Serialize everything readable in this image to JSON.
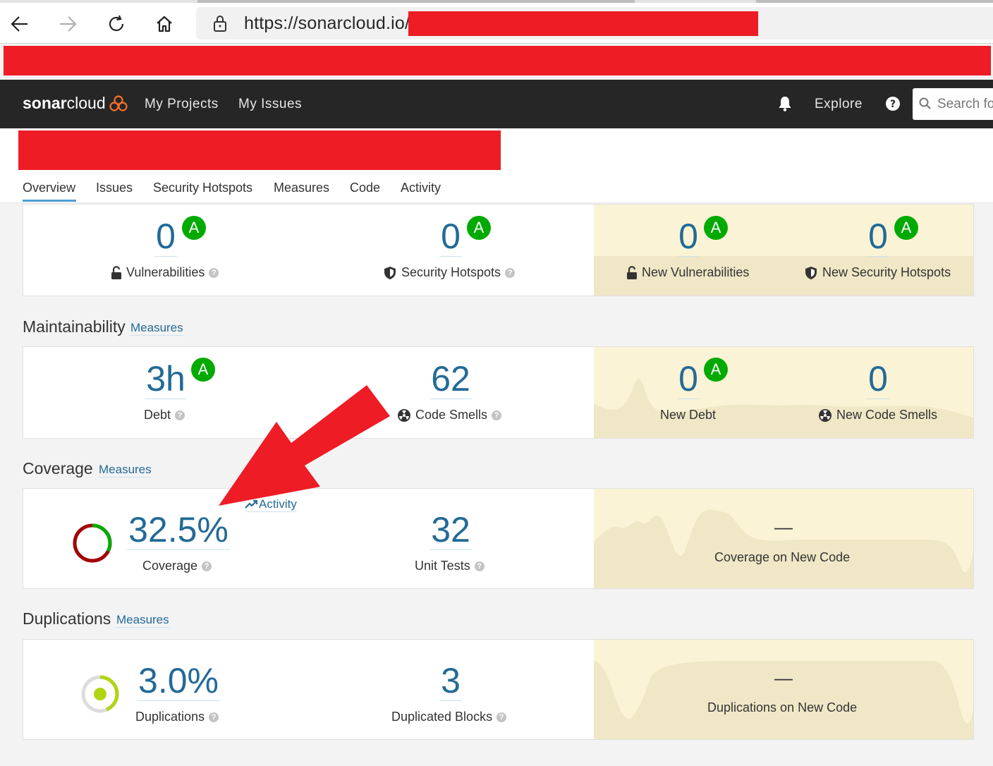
{
  "browser": {
    "url": "https://sonarcloud.io/"
  },
  "header": {
    "logo_bold": "sonar",
    "logo_thin": "cloud",
    "my_projects": "My Projects",
    "my_issues": "My Issues",
    "explore": "Explore",
    "search_placeholder": "Search fo"
  },
  "tabs": [
    "Overview",
    "Issues",
    "Security Hotspots",
    "Measures",
    "Code",
    "Activity"
  ],
  "security": {
    "vulnerabilities": {
      "value": "0",
      "grade": "A",
      "label": "Vulnerabilities"
    },
    "hotspots": {
      "value": "0",
      "grade": "A",
      "label": "Security Hotspots"
    },
    "new_vulnerabilities": {
      "value": "0",
      "grade": "A",
      "label": "New Vulnerabilities"
    },
    "new_hotspots": {
      "value": "0",
      "grade": "A",
      "label": "New Security Hotspots"
    }
  },
  "maintainability": {
    "title": "Maintainability",
    "link": "Measures",
    "debt": {
      "value": "3h",
      "grade": "A",
      "label": "Debt"
    },
    "code_smells": {
      "value": "62",
      "label": "Code Smells"
    },
    "new_debt": {
      "value": "0",
      "grade": "A",
      "label": "New Debt"
    },
    "new_code_smells": {
      "value": "0",
      "label": "New Code Smells"
    }
  },
  "coverage": {
    "title": "Coverage",
    "link": "Measures",
    "activity_link": "Activity",
    "coverage": {
      "value": "32.5%",
      "label": "Coverage",
      "percent": 32.5
    },
    "unit_tests": {
      "value": "32",
      "label": "Unit Tests"
    },
    "new_code": {
      "value": "—",
      "label": "Coverage on New Code"
    }
  },
  "duplications": {
    "title": "Duplications",
    "link": "Measures",
    "duplications": {
      "value": "3.0%",
      "label": "Duplications"
    },
    "blocks": {
      "value": "3",
      "label": "Duplicated Blocks"
    },
    "new_code": {
      "value": "—",
      "label": "Duplications on New Code"
    }
  },
  "colors": {
    "link": "#236a97",
    "grade_a": "#00aa00",
    "new_code_bg": "#fbf3d5",
    "nav_bg": "#262626",
    "coverage_ok": "#00aa00",
    "coverage_bad": "#a40000",
    "duplication": "#b0d513",
    "redaction": "#ee1c25"
  }
}
